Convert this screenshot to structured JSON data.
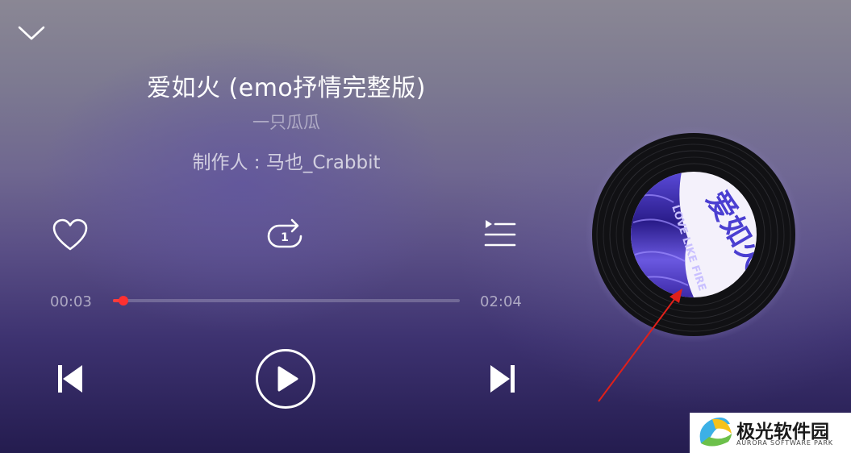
{
  "song": {
    "title": "爱如火 (emo抒情完整版)",
    "artist": "一只瓜瓜",
    "producer": "制作人 : 马也_Crabbit"
  },
  "progress": {
    "current_time": "00:03",
    "total_time": "02:04",
    "fraction": 0.03
  },
  "controls": {
    "favorite_icon": "heart-icon",
    "repeat_icon": "repeat-one-icon",
    "repeat_badge": "1",
    "playlist_icon": "playlist-icon",
    "prev_icon": "skip-previous-icon",
    "play_icon": "play-icon",
    "next_icon": "skip-next-icon",
    "collapse_icon": "chevron-down-icon"
  },
  "album_art": {
    "cover_text": "爱如火",
    "cover_subtext": "LOVE LIKE FIRE"
  },
  "colors": {
    "progress": "#ff3b3b",
    "cover_text": "#4b3fd1"
  },
  "watermark": {
    "name": "极光软件园",
    "sub": "AURORA SOFTWARE PARK"
  }
}
